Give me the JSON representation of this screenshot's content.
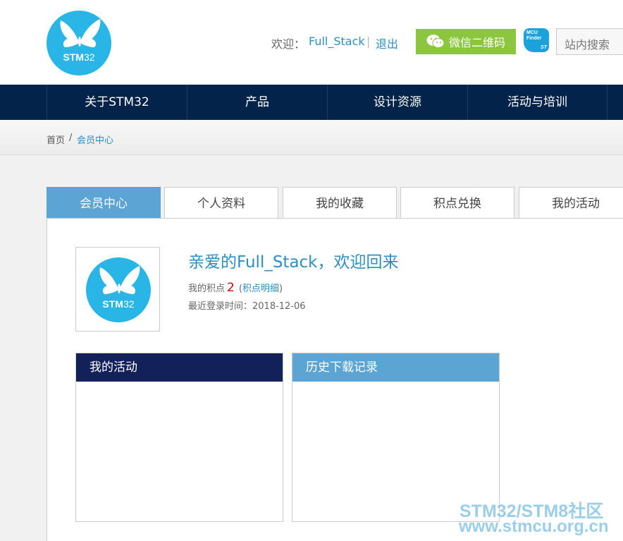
{
  "header": {
    "logo_text_bold": "STM",
    "logo_text_thin": "32",
    "welcome_label": "欢迎：",
    "username": "Full_Stack",
    "separator": "|",
    "logout_label": "退出",
    "wechat_label": "微信二维码",
    "mcu_finder_line1": "MCU",
    "mcu_finder_line2": "Finder",
    "mcu_finder_brand": "ST",
    "search_placeholder": "站内搜索"
  },
  "nav": {
    "items": [
      {
        "label": "关于STM32"
      },
      {
        "label": "产品"
      },
      {
        "label": "设计资源"
      },
      {
        "label": "活动与培训"
      }
    ]
  },
  "breadcrumb": {
    "home": "首页",
    "separator": "/",
    "current": "会员中心"
  },
  "tabs": [
    {
      "label": "会员中心",
      "active": true
    },
    {
      "label": "个人资料"
    },
    {
      "label": "我的收藏"
    },
    {
      "label": "积点兑换"
    },
    {
      "label": "我的活动"
    }
  ],
  "profile": {
    "avatar_text_bold": "STM",
    "avatar_text_thin": "32",
    "greeting": "亲爱的Full_Stack，欢迎回来",
    "points_label": "我的积点",
    "points_value": "2",
    "points_link_open": "(",
    "points_link": "积点明细",
    "points_link_close": ")",
    "last_login_label": "最近登录时间：",
    "last_login_date": "2018-12-06"
  },
  "boxes": {
    "activity_title": "我的活动",
    "downloads_title": "历史下载记录"
  },
  "watermark": {
    "line1": "STM32/STM8社区",
    "line2": "www.stmcu.org.cn"
  },
  "colors": {
    "nav_bg": "#03234b",
    "tab_active": "#5ba4d3",
    "box_dark": "#13215a",
    "box_light": "#5ba4d3",
    "wechat_green": "#8cc63f",
    "link_blue": "#2a8fc8"
  }
}
